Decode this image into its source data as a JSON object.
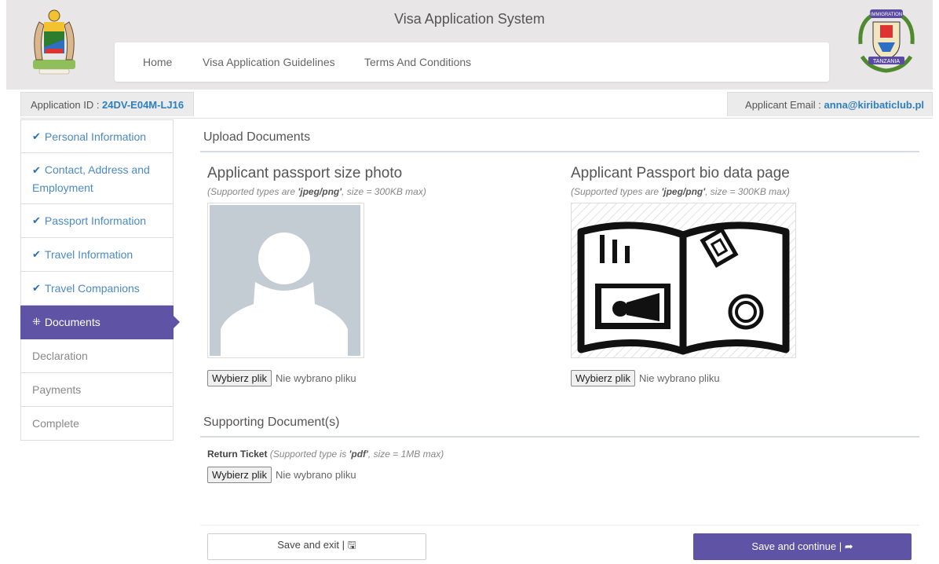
{
  "header": {
    "title": "Visa Application System",
    "nav": [
      {
        "label": "Home"
      },
      {
        "label": "Visa Application Guidelines"
      },
      {
        "label": "Terms And Conditions"
      }
    ],
    "logo_right_text_top": "IMMIGRATION",
    "logo_right_text_bottom": "TANZANIA"
  },
  "infobar": {
    "app_id_label": "Application ID : ",
    "app_id_value": "24DV-E04M-LJ16",
    "email_label": "Applicant Email : ",
    "email_value": "anna@kiribaticlub.pl"
  },
  "sidebar": {
    "items": [
      {
        "label": "Personal Information",
        "state": "done"
      },
      {
        "label": "Contact, Address and Employment",
        "state": "done"
      },
      {
        "label": "Passport Information",
        "state": "done"
      },
      {
        "label": "Travel Information",
        "state": "done"
      },
      {
        "label": "Travel Companions",
        "state": "done"
      },
      {
        "label": "Documents",
        "state": "active"
      },
      {
        "label": "Declaration",
        "state": "pending"
      },
      {
        "label": "Payments",
        "state": "pending"
      },
      {
        "label": "Complete",
        "state": "pending"
      }
    ]
  },
  "upload": {
    "section_title": "Upload Documents",
    "photo": {
      "title": "Applicant passport size photo",
      "note_prefix": "(Supported types are ",
      "note_types": "'jpeg/png'",
      "note_suffix": ", size = 300KB max)",
      "button": "Wybierz plik",
      "status": "Nie wybrano pliku"
    },
    "bio": {
      "title": "Applicant Passport bio data page",
      "note_prefix": "(Supported types are ",
      "note_types": "'jpeg/png'",
      "note_suffix": ", size = 300KB max)",
      "button": "Wybierz plik",
      "status": "Nie wybrano pliku"
    }
  },
  "supporting": {
    "section_title": "Supporting Document(s)",
    "return_ticket": {
      "label": "Return Ticket",
      "note_prefix": " (Supported type is ",
      "note_types": "'pdf'",
      "note_suffix": ", size = 1MB max)",
      "button": "Wybierz plik",
      "status": "Nie wybrano pliku"
    }
  },
  "actions": {
    "save_exit": "Save and exit | 🖫",
    "save_continue": "Save and continue | ➦"
  },
  "colors": {
    "accent": "#5f53a6",
    "link_blue": "#2e7fbf",
    "done_blue": "#4b8ac4"
  }
}
